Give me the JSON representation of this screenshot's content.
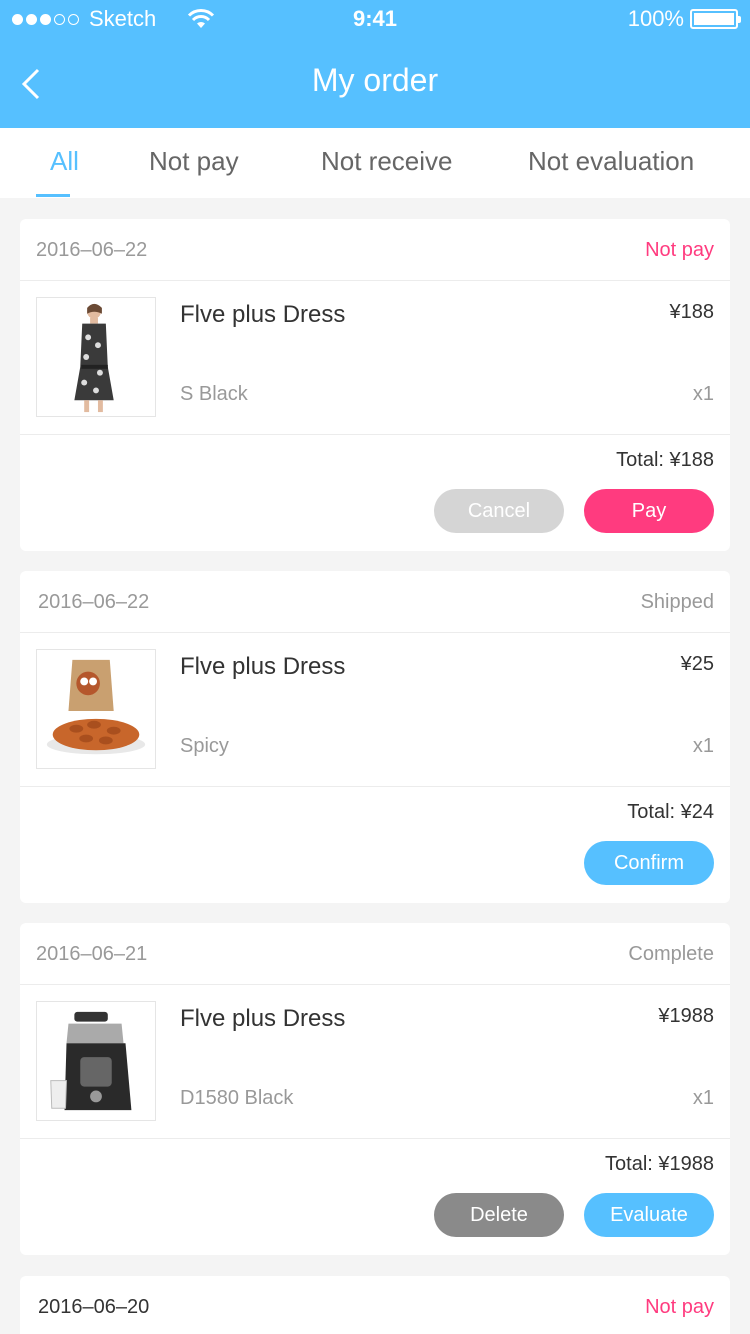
{
  "status_bar": {
    "carrier": "Sketch",
    "time": "9:41",
    "battery": "100%"
  },
  "nav": {
    "title": "My order"
  },
  "tabs": [
    {
      "label": "All"
    },
    {
      "label": "Not pay"
    },
    {
      "label": "Not receive"
    },
    {
      "label": "Not evaluation"
    }
  ],
  "colors": {
    "accent": "#56C0FF",
    "pink": "#FF3B7F",
    "text_main": "#333333",
    "text_sub": "#999999",
    "tab_text": "#666666"
  },
  "orders": [
    {
      "date": "2016–06–22",
      "status": "Not pay",
      "name": "Flve plus Dress",
      "price": "¥188",
      "spec": "S  Black",
      "qty": "x1",
      "total": "Total: ¥188",
      "buttons": [
        "Cancel",
        "Pay"
      ],
      "image": "dress-image"
    },
    {
      "date": "2016–06–22",
      "status": "Shipped",
      "name": "Flve plus Dress",
      "price": "¥25",
      "spec": "Spicy",
      "qty": "x1",
      "total": "Total: ¥24",
      "buttons": [
        "Confirm"
      ],
      "image": "almonds-image"
    },
    {
      "date": "2016–06–21",
      "status": "Complete",
      "name": "Flve plus Dress",
      "price": "¥1988",
      "spec": "D1580    Black",
      "qty": "x1",
      "total": "Total: ¥1988",
      "buttons": [
        "Delete",
        "Evaluate"
      ],
      "image": "juicer-image"
    },
    {
      "date": "2016–06–20",
      "status": "Not pay"
    }
  ]
}
